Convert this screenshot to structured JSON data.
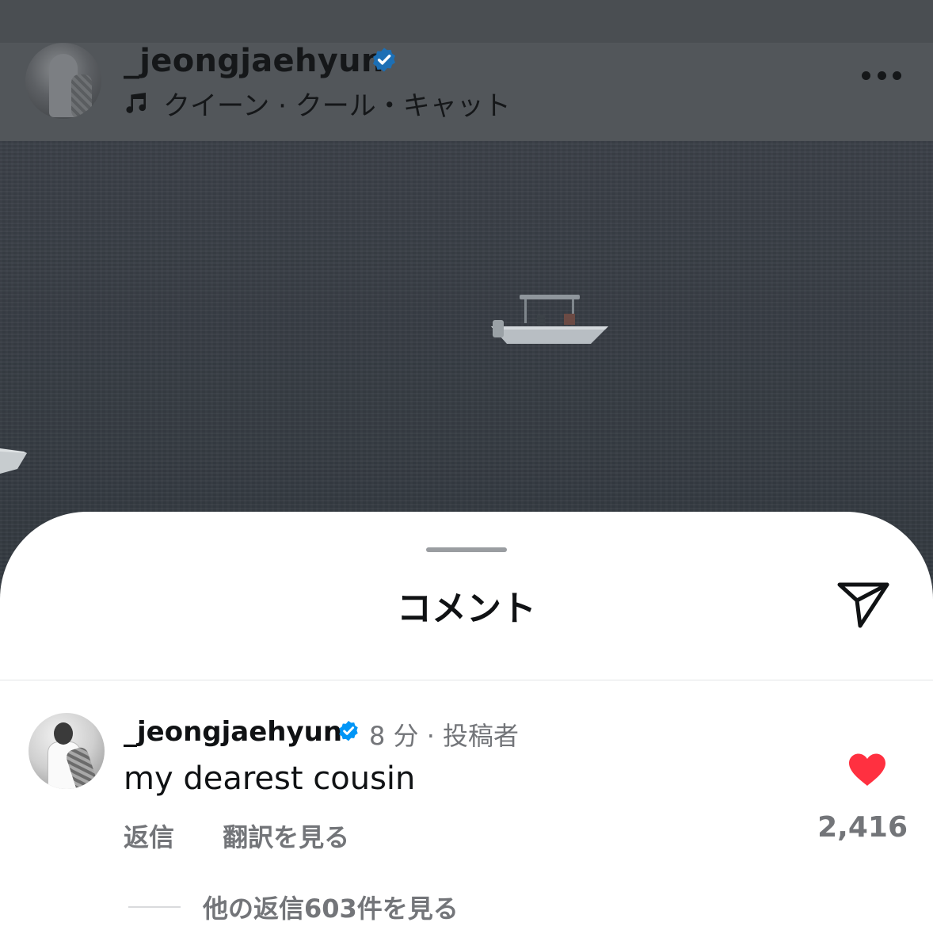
{
  "post": {
    "username": "_jeongjaehyun",
    "music": "クイーン · クール・キャット",
    "icons": {
      "avatar": "profile-photo",
      "verified": "verified-badge-icon",
      "music": "music-note-icon",
      "more": "more-options-icon"
    }
  },
  "sheet": {
    "title": "コメント",
    "icons": {
      "send": "send-icon"
    }
  },
  "comment": {
    "username": "_jeongjaehyun",
    "meta": "8 分 · 投稿者",
    "text": "my dearest cousin",
    "reply_label": "返信",
    "translate_label": "翻訳を見る",
    "likes": "2,416",
    "view_replies": "他の返信603件を見る",
    "icons": {
      "like": "heart-icon"
    }
  },
  "colors": {
    "verified_blue": "#0095f6",
    "like_red": "#ff3040",
    "secondary_text": "#737579"
  }
}
